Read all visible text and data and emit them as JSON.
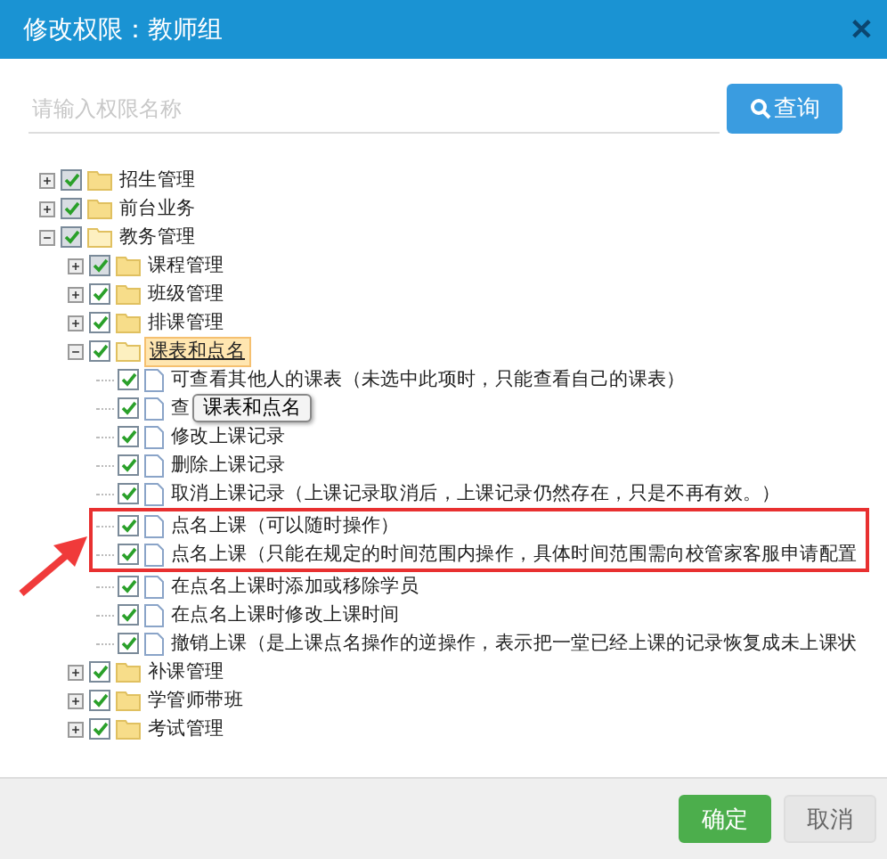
{
  "window": {
    "title": "修改权限：教师组",
    "close": "✕"
  },
  "search": {
    "placeholder": "请输入权限名称",
    "button": "查询"
  },
  "tree": [
    {
      "label": "招生管理",
      "kind": "folder",
      "checked": true,
      "partial": true,
      "expanded": false
    },
    {
      "label": "前台业务",
      "kind": "folder",
      "checked": true,
      "partial": true,
      "expanded": false
    },
    {
      "label": "教务管理",
      "kind": "folder",
      "checked": true,
      "partial": true,
      "expanded": true,
      "children": [
        {
          "label": "课程管理",
          "kind": "folder",
          "checked": true,
          "partial": true,
          "expanded": false
        },
        {
          "label": "班级管理",
          "kind": "folder",
          "checked": true,
          "partial": false,
          "expanded": false
        },
        {
          "label": "排课管理",
          "kind": "folder",
          "checked": true,
          "partial": false,
          "expanded": false
        },
        {
          "label": "课表和点名",
          "kind": "folder",
          "checked": true,
          "partial": false,
          "expanded": true,
          "selected": true,
          "tooltip": "课表和点名",
          "children": [
            {
              "label": "可查看其他人的课表（未选中此项时，只能查看自己的课表）",
              "kind": "file",
              "checked": true,
              "highlighted": false
            },
            {
              "label": "查",
              "kind": "file",
              "checked": true,
              "highlighted": false
            },
            {
              "label": "修改上课记录",
              "kind": "file",
              "checked": true,
              "highlighted": false
            },
            {
              "label": "删除上课记录",
              "kind": "file",
              "checked": true,
              "highlighted": false
            },
            {
              "label": "取消上课记录（上课记录取消后，上课记录仍然存在，只是不再有效。）",
              "kind": "file",
              "checked": true,
              "highlighted": false
            },
            {
              "label": "点名上课（可以随时操作）",
              "kind": "file",
              "checked": true,
              "highlighted": true
            },
            {
              "label": "点名上课（只能在规定的时间范围内操作，具体时间范围需向校管家客服申请配置",
              "kind": "file",
              "checked": true,
              "highlighted": true
            },
            {
              "label": "在点名上课时添加或移除学员",
              "kind": "file",
              "checked": true,
              "highlighted": false
            },
            {
              "label": "在点名上课时修改上课时间",
              "kind": "file",
              "checked": true,
              "highlighted": false
            },
            {
              "label": "撤销上课（是上课点名操作的逆操作，表示把一堂已经上课的记录恢复成未上课状",
              "kind": "file",
              "checked": true,
              "highlighted": false
            }
          ]
        },
        {
          "label": "补课管理",
          "kind": "folder",
          "checked": true,
          "partial": false,
          "expanded": false
        },
        {
          "label": "学管师带班",
          "kind": "folder",
          "checked": true,
          "partial": false,
          "expanded": false
        },
        {
          "label": "考试管理",
          "kind": "folder",
          "checked": true,
          "partial": false,
          "expanded": false
        }
      ]
    }
  ],
  "buttons": [
    {
      "label": "确定",
      "kind": "primary"
    },
    {
      "label": "取消",
      "kind": "secondary"
    }
  ]
}
